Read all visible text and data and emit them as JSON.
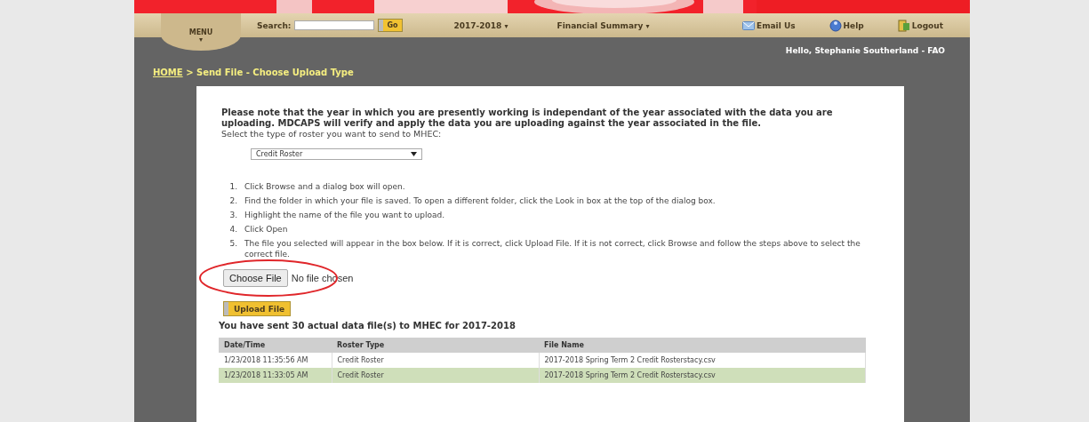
{
  "nav": {
    "menu": {
      "label": "MENU",
      "caret": "▾"
    },
    "search": {
      "label": "Search:",
      "button": "Go"
    },
    "items": [
      {
        "label": "2017-2018",
        "caret": "▾"
      },
      {
        "label": "Financial Summary",
        "caret": "▾"
      }
    ],
    "links": [
      {
        "label": "Email Us",
        "kind": "email"
      },
      {
        "label": "Help",
        "kind": "help"
      },
      {
        "label": "Logout",
        "kind": "logout"
      }
    ]
  },
  "greeting": "Hello, Stephanie Southerland - FAO",
  "breadcrumb": {
    "home": "HOME",
    "current": " > Send File - Choose Upload Type"
  },
  "notice": "Please note that the year in which you are presently working is independant of the year associated with the data you are uploading. MDCAPS will verify and apply the data you are uploading against the year associated in the file.",
  "select_prompt": "Select the type of roster you want to send to MHEC:",
  "roster_select": {
    "value": "Credit Roster"
  },
  "steps": [
    {
      "number": "1.",
      "text": "Click Browse and a dialog box will open."
    },
    {
      "number": "2.",
      "text": "Find the folder in which your file is saved. To open a different folder, click the Look in box at the top of the dialog box."
    },
    {
      "number": "3.",
      "text": "Highlight the name of the file you want to upload."
    },
    {
      "number": "4.",
      "text": "Click Open"
    },
    {
      "number": "5.",
      "text": "The file you selected will appear in the box below. If it is correct,  click Upload File.  If it is not correct, click Browse and follow the steps above to select the correct file."
    }
  ],
  "file_input": {
    "button": "Choose File",
    "status": "No file chosen",
    "circled": true
  },
  "upload_button": "Upload File",
  "sent_summary": "You have sent 30 actual data file(s) to MHEC for 2017-2018",
  "table": {
    "columns": [
      "Date/Time",
      "Roster Type",
      "File Name"
    ],
    "rows": [
      {
        "cells": [
          "1/23/2018 11:35:56 AM",
          "Credit Roster",
          "2017-2018 Spring Term 2 Credit Rosterstacy.csv"
        ],
        "selected": false
      },
      {
        "cells": [
          "1/23/2018 11:33:05 AM",
          "Credit Roster",
          "2017-2018 Spring Term 2 Credit Rosterstacy.csv"
        ],
        "selected": true
      }
    ]
  }
}
